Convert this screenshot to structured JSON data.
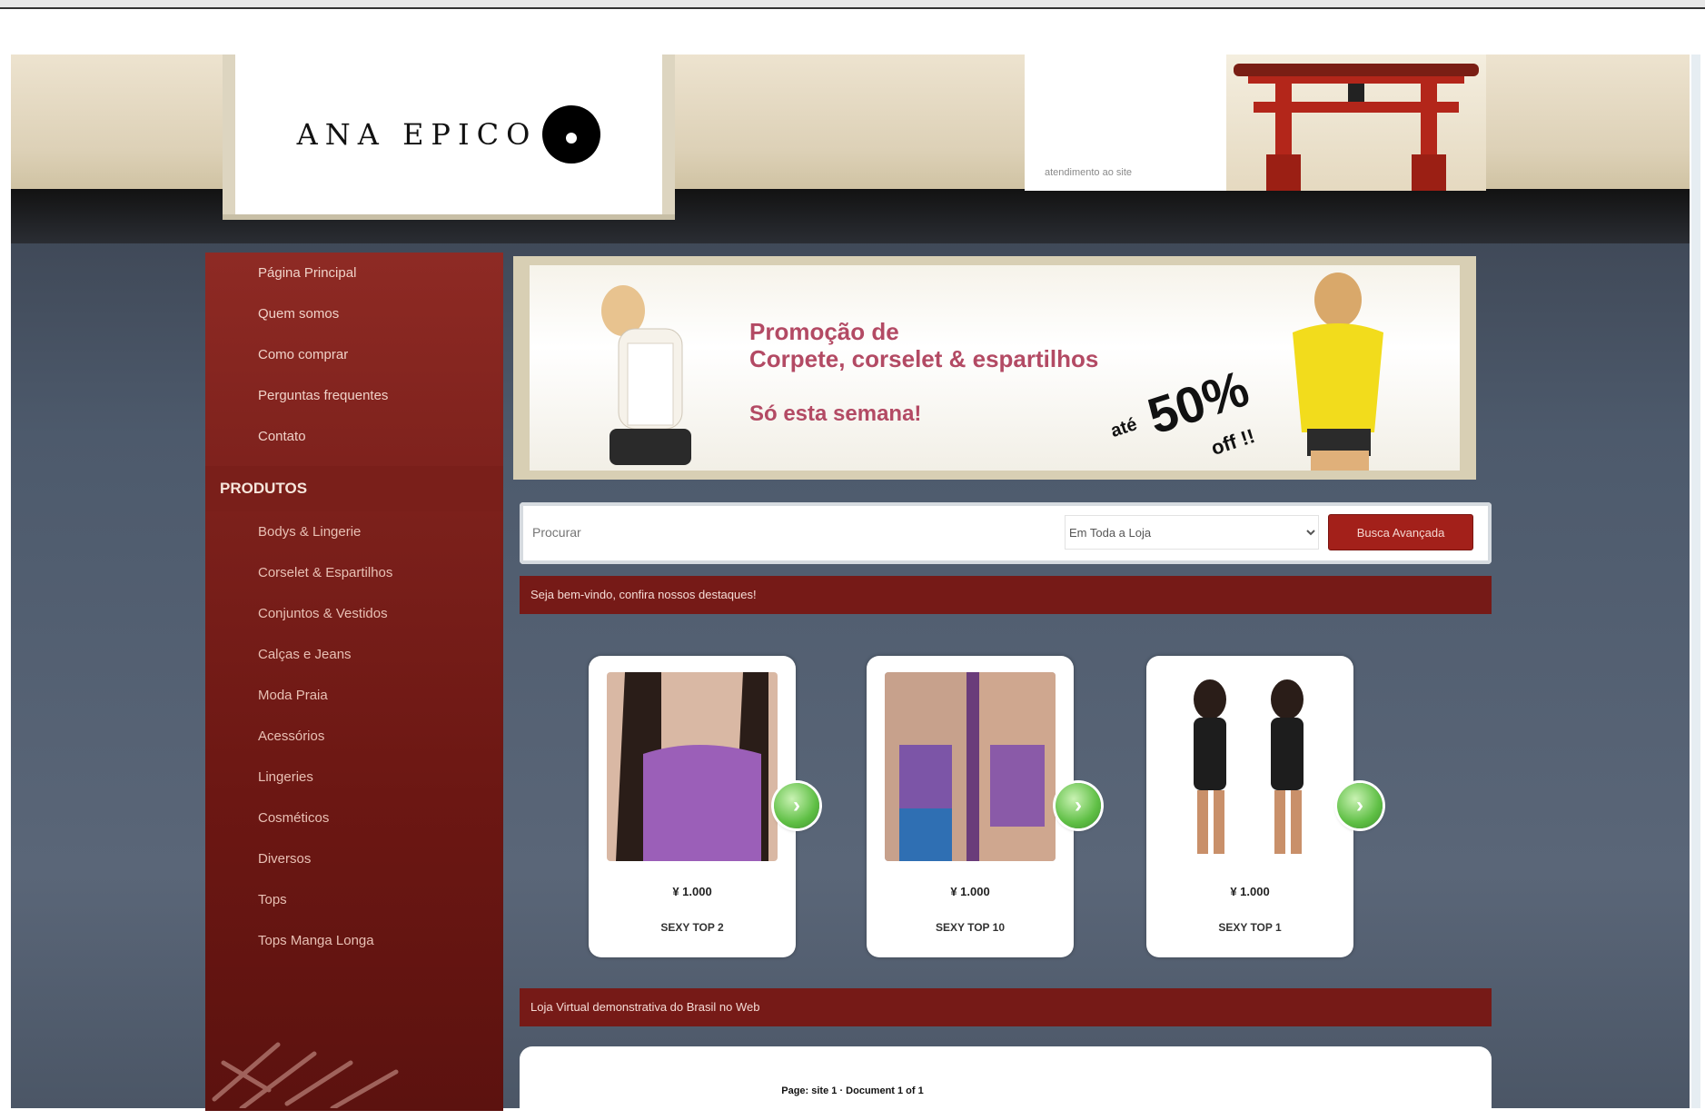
{
  "logo": {
    "text": "ANA EPICO"
  },
  "header": {
    "note": "atendimento ao site"
  },
  "sidebar": {
    "menu": [
      {
        "label": "Página Principal"
      },
      {
        "label": "Quem somos"
      },
      {
        "label": "Como comprar"
      },
      {
        "label": "Perguntas frequentes"
      },
      {
        "label": "Contato"
      }
    ],
    "products_heading": "PRODUTOS",
    "products": [
      {
        "label": "Bodys & Lingerie"
      },
      {
        "label": "Corselet & Espartilhos"
      },
      {
        "label": "Conjuntos & Vestidos"
      },
      {
        "label": "Calças e Jeans"
      },
      {
        "label": "Moda Praia"
      },
      {
        "label": "Acessórios"
      },
      {
        "label": "Lingeries"
      },
      {
        "label": "Cosméticos"
      },
      {
        "label": "Diversos"
      },
      {
        "label": "Tops"
      },
      {
        "label": "Tops Manga Longa"
      }
    ]
  },
  "banner": {
    "title_line1": "Promoção de",
    "title_line2": "Corpete, corselet & espartilhos",
    "subtitle": "Só esta semana!",
    "ate": "até",
    "percent": "50%",
    "off": "off !!"
  },
  "search": {
    "placeholder": "Procurar",
    "select_value": "Em Toda a Loja",
    "button_label": "Busca Avançada"
  },
  "welcome_bar": "Seja bem-vindo, confira nossos destaques!",
  "products": [
    {
      "price": "¥ 1.000",
      "name": "SEXY TOP 2"
    },
    {
      "price": "¥ 1.000",
      "name": "SEXY TOP 10"
    },
    {
      "price": "¥ 1.000",
      "name": "SEXY TOP 1"
    }
  ],
  "demo_bar": "Loja Virtual demonstrativa do Brasil no Web",
  "footer": "Page: site 1 · Document 1 of 1",
  "colors": {
    "accent": "#a3201a",
    "sidebar": "#7d211c",
    "banner_text": "#b34a64"
  }
}
